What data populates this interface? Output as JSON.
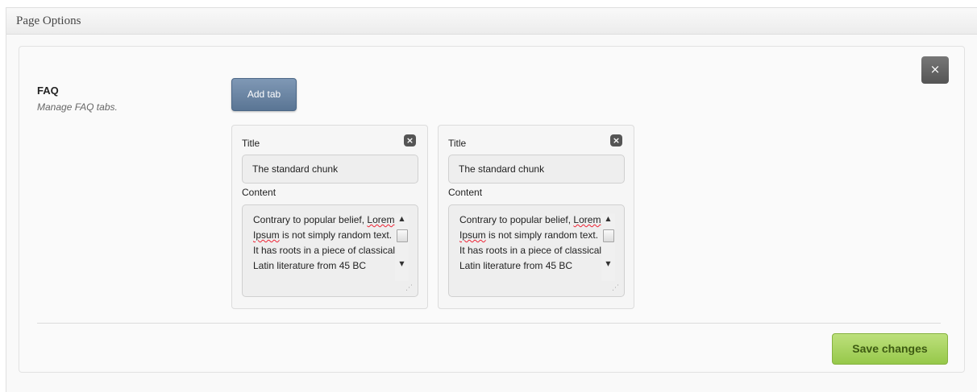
{
  "panel": {
    "title": "Page Options"
  },
  "field": {
    "title": "FAQ",
    "description": "Manage FAQ tabs."
  },
  "buttons": {
    "add_tab": "Add tab",
    "close": "×",
    "save": "Save changes",
    "tab_remove": "×"
  },
  "tabs": [
    {
      "title_label": "Title",
      "title_value": "The standard chunk",
      "content_label": "Content",
      "content_value": "Contrary to popular belief, Lorem Ipsum is not simply random text. It has roots in a piece of classical Latin literature from 45 BC"
    },
    {
      "title_label": "Title",
      "title_value": "The standard chunk",
      "content_label": "Content",
      "content_value": "Contrary to popular belief, Lorem Ipsum is not simply random text. It has roots in a piece of classical Latin literature from 45 BC"
    }
  ],
  "icons": {
    "close": "close-icon",
    "tab_remove": "remove-tab-icon",
    "scroll_up": "scroll-up-arrow-icon",
    "scroll_down": "scroll-down-arrow-icon",
    "resize": "resize-grip-icon"
  },
  "colors": {
    "add_tab_button": "#6b86a6",
    "save_button": "#a8d65f",
    "close_button": "#666666"
  }
}
